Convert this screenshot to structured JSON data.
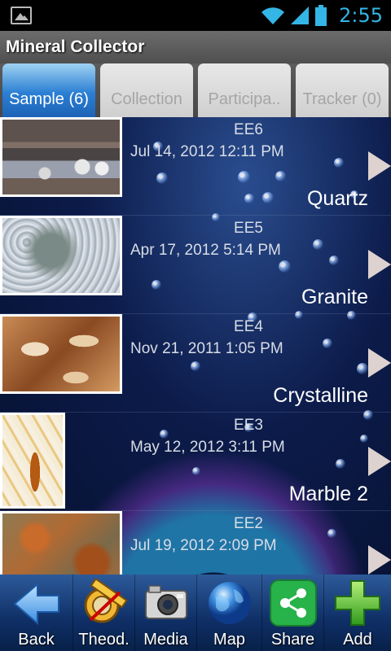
{
  "status_bar": {
    "time": "2:55",
    "left_icon": "picture-notification-icon",
    "icons": [
      "wifi-icon",
      "signal-icon",
      "battery-icon"
    ]
  },
  "app": {
    "title": "Mineral Collector"
  },
  "tabs": [
    {
      "label": "Sample (6)",
      "active": true
    },
    {
      "label": "Collection",
      "active": false
    },
    {
      "label": "Participa..",
      "active": false
    },
    {
      "label": "Tracker (0)",
      "active": false
    }
  ],
  "samples": [
    {
      "id": "EE6",
      "date": "Jul 14, 2012 12:11 PM",
      "name": "Quartz",
      "thumb": "quartz-thumbnail"
    },
    {
      "id": "EE5",
      "date": "Apr 17, 2012 5:14 PM",
      "name": "Granite",
      "thumb": "granite-thumbnail"
    },
    {
      "id": "EE4",
      "date": "Nov 21, 2011 1:05 PM",
      "name": "Crystalline",
      "thumb": "crystalline-thumbnail"
    },
    {
      "id": "EE3",
      "date": "May 12, 2012 3:11 PM",
      "name": "Marble 2",
      "thumb": "marble-thumbnail"
    },
    {
      "id": "EE2",
      "date": "Jul 19, 2012 2:09 PM",
      "name": "",
      "thumb": "mineral-thumbnail"
    }
  ],
  "toolbar": {
    "back": "Back",
    "theod": "Theod.",
    "media": "Media",
    "map": "Map",
    "share": "Share",
    "add": "Add"
  },
  "colors": {
    "accent": "#33b5e5",
    "active_tab": "#2b7fd4",
    "toolbar": "#0f2f66"
  }
}
